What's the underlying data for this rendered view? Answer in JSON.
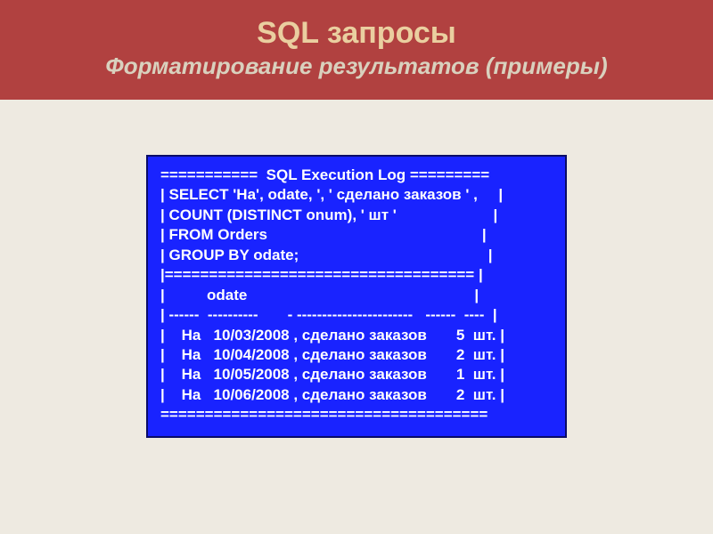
{
  "header": {
    "title": "SQL запросы",
    "subtitle": "Форматирование результатов (примеры)"
  },
  "sql": {
    "lines": [
      "===========  SQL Execution Log =========",
      "| SELECT 'На', odate, ', ' сделано заказов ' ,     |",
      "| COUNT (DISTINCT onum), ' шт '                       |",
      "| FROM Orders                                                   |",
      "| GROUP BY odate;                                             |",
      "|=================================== |",
      "|          odate                                                      |",
      "| ------  ----------       - -----------------------   ------  ----  |",
      "|    На   10/03/2008 , сделано заказов       5  шт. |",
      "|    На   10/04/2008 , сделано заказов       2  шт. |",
      "|    На   10/05/2008 , сделано заказов       1  шт. |",
      "|    На   10/06/2008 , сделано заказов       2  шт. |",
      "====================================="
    ]
  }
}
